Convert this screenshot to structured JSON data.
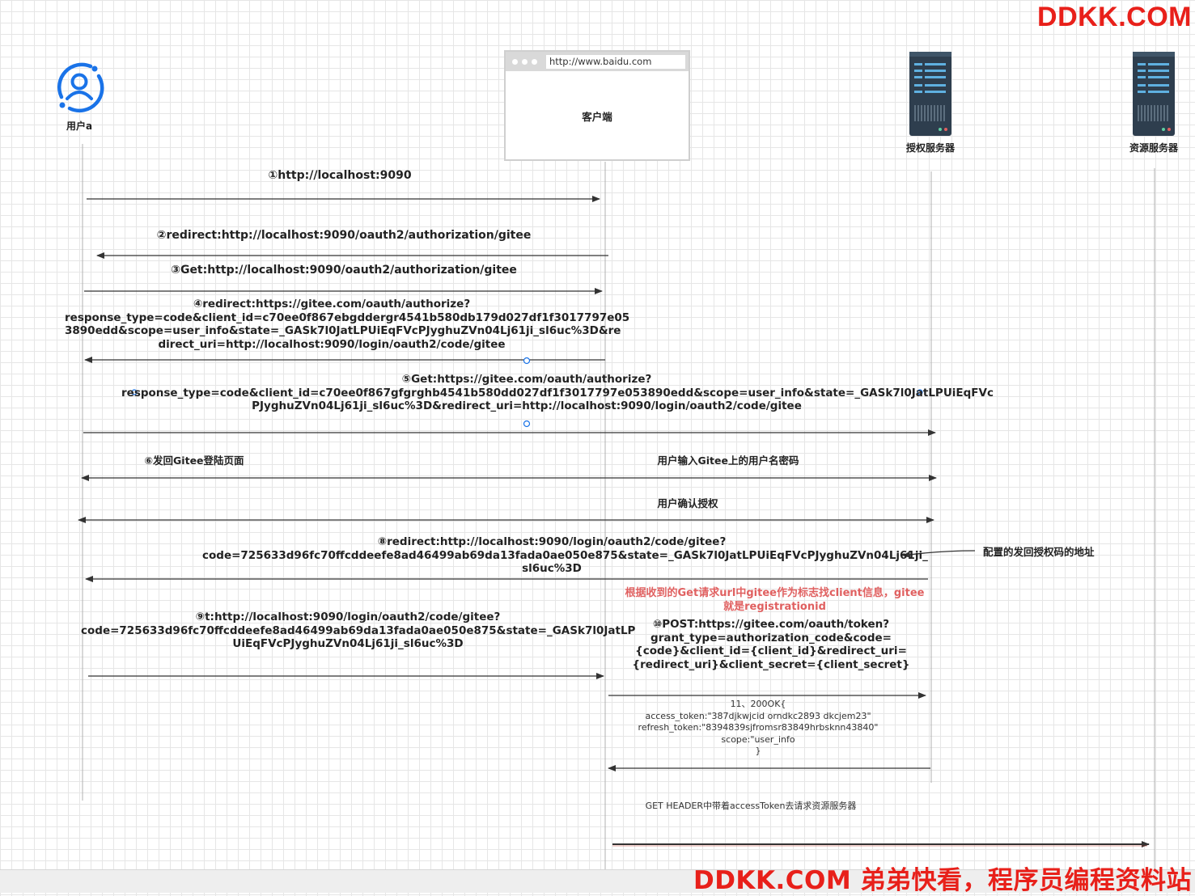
{
  "watermark": {
    "top": "DDKK.COM",
    "bottom": "DDKK.COM 弟弟快看，程序员编程资料站"
  },
  "actors": {
    "user": {
      "label": "用户a",
      "icon": "user-icon"
    },
    "client": {
      "label": "客户端",
      "url": "http://www.baidu.com",
      "icon": "browser-window-icon"
    },
    "auth_server": {
      "label": "授权服务器",
      "icon": "server-icon"
    },
    "resource_server": {
      "label": "资源服务器",
      "icon": "server-icon"
    }
  },
  "messages": {
    "m1": "①http://localhost:9090",
    "m2": "②redirect:http://localhost:9090/oauth2/authorization/gitee",
    "m3": "③Get:http://localhost:9090/oauth2/authorization/gitee",
    "m4": "④redirect:https://gitee.com/oauth/authorize?\nresponse_type=code&client_id=c70ee0f867ebgddergr4541b580db179d027df1f3017797e05\n3890edd&scope=user_info&state=_GASk7l0JatLPUiEqFVcPJyghuZVn04Lj61ji_sl6uc%3D&re\ndirect_uri=http://localhost:9090/login/oauth2/code/gitee",
    "m5": "⑤Get:https://gitee.com/oauth/authorize?\nresponse_type=code&client_id=c70ee0f867gfgrghb4541b580dd027df1f3017797e053890edd&scope=user_info&state=_GASk7l0JatLPUiEqFVc\nPJyghuZVn04Lj61ji_sl6uc%3D&redirect_uri=http://localhost:9090/login/oauth2/code/gitee",
    "m6_left": "⑥发回Gitee登陆页面",
    "m6_right": "用户输入Gitee上的用户名密码",
    "m7": "用户确认授权",
    "m8": "⑧redirect:http://localhost:9090/login/oauth2/code/gitee?\ncode=725633d96fc70ffcddeefe8ad46499ab69da13fada0ae050e875&state=_GASk7l0JatLPUiEqFVcPJyghuZVn04Lj61ji_\nsl6uc%3D",
    "m8_note": "配置的发回授权码的地址",
    "m9": "⑨t:http://localhost:9090/login/oauth2/code/gitee?\ncode=725633d96fc70ffcddeefe8ad46499ab69da13fada0ae050e875&state=_GASk7l0JatLP\nUiEqFVcPJyghuZVn04Lj61ji_sl6uc%3D",
    "red_note": "根据收到的Get请求url中gitee作为标志找client信息，gitee\n就是registrationid",
    "m10": "⑩POST:https://gitee.com/oauth/token?\ngrant_type=authorization_code&code=\n{code}&client_id={client_id}&redirect_uri=\n{redirect_uri}&client_secret={client_secret}",
    "m11": "11、200OK{\naccess_token:\"387djkwjcid orndkc2893 dkcjem23\"\nrefresh_token:\"8394839sjfromsr83849hrbsknn43840\"\nscope:\"user_info\n}",
    "m12": "GET HEADER中带着accessToken去请求资源服务器"
  },
  "colors": {
    "line": "#333333",
    "lifeline": "#b0b0b0",
    "accent_blue": "#1a73e8",
    "watermark_red": "#e8201a",
    "note_red": "#e06060",
    "server_body": "#2e3e4e"
  }
}
